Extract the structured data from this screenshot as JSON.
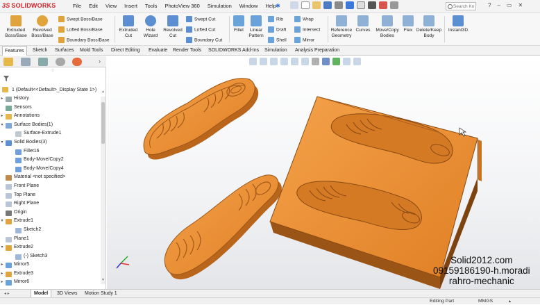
{
  "app": {
    "logo": "SOLIDWORKS"
  },
  "menu": [
    "File",
    "Edit",
    "View",
    "Insert",
    "Tools",
    "PhotoView 360",
    "Simulation",
    "Window",
    "Help"
  ],
  "search": {
    "placeholder": "Search Kn"
  },
  "ribbon": {
    "extruded_boss": "Extruded Boss/Base",
    "revolved_boss": "Revolved Boss/Base",
    "swept_boss": "Swept Boss/Base",
    "lofted_boss": "Lofted Boss/Base",
    "boundary_boss": "Boundary Boss/Base",
    "extruded_cut": "Extruded Cut",
    "hole_wizard": "Hole Wizard",
    "revolved_cut": "Revolved Cut",
    "swept_cut": "Swept Cut",
    "lofted_cut": "Lofted Cut",
    "boundary_cut": "Boundary Cut",
    "fillet": "Fillet",
    "linear_pattern": "Linear Pattern",
    "rib": "Rib",
    "draft": "Draft",
    "shell": "Shell",
    "wrap": "Wrap",
    "intersect": "Intersect",
    "mirror": "Mirror",
    "reference_geometry": "Reference Geometry",
    "curves": "Curves",
    "move_copy": "Move/Copy Bodies",
    "flex": "Flex",
    "delete_keep": "Delete/Keep Body",
    "instant3d": "Instant3D"
  },
  "tabs": [
    "Features",
    "Sketch",
    "Surfaces",
    "Mold Tools",
    "Direct Editing",
    "Evaluate",
    "Render Tools",
    "SOLIDWORKS Add-Ins",
    "Simulation",
    "Analysis Preparation"
  ],
  "tree": {
    "root": "1 (Default<<Default>_Display State 1>)",
    "items": [
      {
        "label": "History",
        "icon": "history-icon",
        "indent": 1,
        "exp": "▸"
      },
      {
        "label": "Sensors",
        "icon": "sensor-icon",
        "indent": 1,
        "exp": ""
      },
      {
        "label": "Annotations",
        "icon": "annotation-icon",
        "indent": 1,
        "exp": "▸"
      },
      {
        "label": "Surface Bodies(1)",
        "icon": "surface-bodies-icon",
        "indent": 1,
        "exp": "▾"
      },
      {
        "label": "Surface-Extrude1",
        "icon": "surface-icon",
        "indent": 2,
        "exp": ""
      },
      {
        "label": "Solid Bodies(3)",
        "icon": "solid-bodies-icon",
        "indent": 1,
        "exp": "▾"
      },
      {
        "label": "Fillet16",
        "icon": "body-icon",
        "indent": 2,
        "exp": ""
      },
      {
        "label": "Body-Move/Copy2",
        "icon": "body-icon",
        "indent": 2,
        "exp": ""
      },
      {
        "label": "Body-Move/Copy4",
        "icon": "body-icon",
        "indent": 2,
        "exp": ""
      },
      {
        "label": "Material <not specified>",
        "icon": "material-icon",
        "indent": 1,
        "exp": ""
      },
      {
        "label": "Front Plane",
        "icon": "plane-icon",
        "indent": 1,
        "exp": ""
      },
      {
        "label": "Top Plane",
        "icon": "plane-icon",
        "indent": 1,
        "exp": ""
      },
      {
        "label": "Right Plane",
        "icon": "plane-icon",
        "indent": 1,
        "exp": ""
      },
      {
        "label": "Origin",
        "icon": "origin-icon",
        "indent": 1,
        "exp": ""
      },
      {
        "label": "Extrude1",
        "icon": "extrude-icon",
        "indent": 1,
        "exp": "▾"
      },
      {
        "label": "Sketch2",
        "icon": "sketch-icon",
        "indent": 2,
        "exp": ""
      },
      {
        "label": "Plane1",
        "icon": "plane-icon",
        "indent": 1,
        "exp": ""
      },
      {
        "label": "Extrude2",
        "icon": "extrude-icon",
        "indent": 1,
        "exp": "▾"
      },
      {
        "label": "(-) Sketch3",
        "icon": "sketch-icon",
        "indent": 2,
        "exp": ""
      },
      {
        "label": "Mirror5",
        "icon": "mirror-icon",
        "indent": 1,
        "exp": "▸"
      },
      {
        "label": "Extrude3",
        "icon": "extrude-icon",
        "indent": 1,
        "exp": "▸"
      },
      {
        "label": "Mirror6",
        "icon": "mirror-icon",
        "indent": 1,
        "exp": "▸"
      }
    ]
  },
  "watermark": {
    "line1": "Solid2012.com",
    "line2": "09159186190-h.moradi",
    "line3": "rahro-mechanic"
  },
  "bottom_tabs": [
    "Model",
    "3D Views",
    "Motion Study 1"
  ],
  "status": {
    "mode": "Editing Part",
    "units": "MMGS"
  },
  "colors": {
    "part_orange": "#e8923a",
    "part_dark": "#b8621a",
    "accent_red": "#d2232a"
  }
}
